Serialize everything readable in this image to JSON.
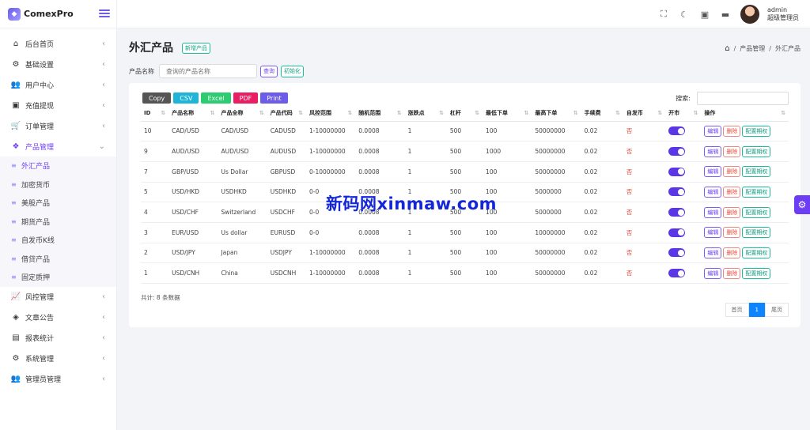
{
  "brand": {
    "name": "ComexPro"
  },
  "user": {
    "name": "admin",
    "role": "超级管理员"
  },
  "sidebar": {
    "items": [
      {
        "label": "后台首页",
        "icon": "home-icon",
        "glyph": "⌂"
      },
      {
        "label": "基础设置",
        "icon": "cogs-icon",
        "glyph": "⚙"
      },
      {
        "label": "用户中心",
        "icon": "users-icon",
        "glyph": "👥"
      },
      {
        "label": "充值提现",
        "icon": "money-icon",
        "glyph": "▣"
      },
      {
        "label": "订单管理",
        "icon": "cart-icon",
        "glyph": "🛒"
      },
      {
        "label": "产品管理",
        "icon": "cubes-icon",
        "glyph": "❖"
      }
    ],
    "sub": [
      {
        "label": "外汇产品"
      },
      {
        "label": "加密货币"
      },
      {
        "label": "美股产品"
      },
      {
        "label": "期货产品"
      },
      {
        "label": "自发币K线"
      },
      {
        "label": "借贷产品"
      },
      {
        "label": "固定质押"
      }
    ],
    "items2": [
      {
        "label": "风控管理",
        "icon": "chart-line-icon",
        "glyph": "📈"
      },
      {
        "label": "文章公告",
        "icon": "layers-icon",
        "glyph": "◈"
      },
      {
        "label": "报表统计",
        "icon": "reports-icon",
        "glyph": "▤"
      },
      {
        "label": "系统管理",
        "icon": "gear-icon",
        "glyph": "⚙"
      },
      {
        "label": "管理员管理",
        "icon": "admins-icon",
        "glyph": "👥"
      }
    ]
  },
  "page": {
    "title": "外汇产品",
    "add_label": "新增产品"
  },
  "breadcrumb": {
    "items": [
      "产品管理",
      "外汇产品"
    ],
    "sep": "/"
  },
  "search": {
    "label": "产品名称",
    "placeholder": "查询的产品名称",
    "query": "查询",
    "reset": "初始化"
  },
  "exports": [
    {
      "label": "Copy",
      "color": "#555555"
    },
    {
      "label": "CSV",
      "color": "#1fb5d8"
    },
    {
      "label": "Excel",
      "color": "#2ecc71"
    },
    {
      "label": "PDF",
      "color": "#e91e63"
    },
    {
      "label": "Print",
      "color": "#6c5ce7"
    }
  ],
  "table_search_label": "搜索:",
  "columns": [
    "ID",
    "产品名称",
    "产品全称",
    "产品代码",
    "风控范围",
    "随机范围",
    "涨跌点",
    "杠杆",
    "最低下单",
    "最高下单",
    "手续费",
    "自发币",
    "开市",
    "操作"
  ],
  "rows": [
    {
      "id": "10",
      "name": "CAD/USD",
      "full": "CAD/USD",
      "code": "CADUSD",
      "risk": "1-10000000",
      "rand": "0.0008",
      "pts": "1",
      "lev": "500",
      "min": "100",
      "max": "50000000",
      "fee": "0.02",
      "self": "否"
    },
    {
      "id": "9",
      "name": "AUD/USD",
      "full": "AUD/USD",
      "code": "AUDUSD",
      "risk": "1-10000000",
      "rand": "0.0008",
      "pts": "1",
      "lev": "500",
      "min": "1000",
      "max": "50000000",
      "fee": "0.02",
      "self": "否"
    },
    {
      "id": "7",
      "name": "GBP/USD",
      "full": "Us Dollar",
      "code": "GBPUSD",
      "risk": "0-10000000",
      "rand": "0.0008",
      "pts": "1",
      "lev": "500",
      "min": "100",
      "max": "50000000",
      "fee": "0.02",
      "self": "否"
    },
    {
      "id": "5",
      "name": "USD/HKD",
      "full": "USDHKD",
      "code": "USDHKD",
      "risk": "0-0",
      "rand": "0.0008",
      "pts": "1",
      "lev": "500",
      "min": "100",
      "max": "5000000",
      "fee": "0.02",
      "self": "否"
    },
    {
      "id": "4",
      "name": "USD/CHF",
      "full": "Switzerland",
      "code": "USDCHF",
      "risk": "0-0",
      "rand": "0.0008",
      "pts": "1",
      "lev": "500",
      "min": "100",
      "max": "5000000",
      "fee": "0.02",
      "self": "否"
    },
    {
      "id": "3",
      "name": "EUR/USD",
      "full": "Us dollar",
      "code": "EURUSD",
      "risk": "0-0",
      "rand": "0.0008",
      "pts": "1",
      "lev": "500",
      "min": "100",
      "max": "10000000",
      "fee": "0.02",
      "self": "否"
    },
    {
      "id": "2",
      "name": "USD/JPY",
      "full": "Japan",
      "code": "USDJPY",
      "risk": "1-10000000",
      "rand": "0.0008",
      "pts": "1",
      "lev": "500",
      "min": "100",
      "max": "50000000",
      "fee": "0.02",
      "self": "否"
    },
    {
      "id": "1",
      "name": "USD/CNH",
      "full": "China",
      "code": "USDCNH",
      "risk": "1-10000000",
      "rand": "0.0008",
      "pts": "1",
      "lev": "500",
      "min": "100",
      "max": "50000000",
      "fee": "0.02",
      "self": "否"
    }
  ],
  "row_actions": {
    "edit": "编辑",
    "delete": "删除",
    "config": "配置期权"
  },
  "total_text": "共计: 8 条数据",
  "pagination": {
    "first": "首页",
    "current": "1",
    "last": "尾页"
  },
  "watermark": "新码网xinmaw.com",
  "colors": {
    "accent": "#6c3df4",
    "toggle_on": "#5b35e8",
    "page_active": "#0d84ff",
    "danger": "#e74c3c"
  }
}
